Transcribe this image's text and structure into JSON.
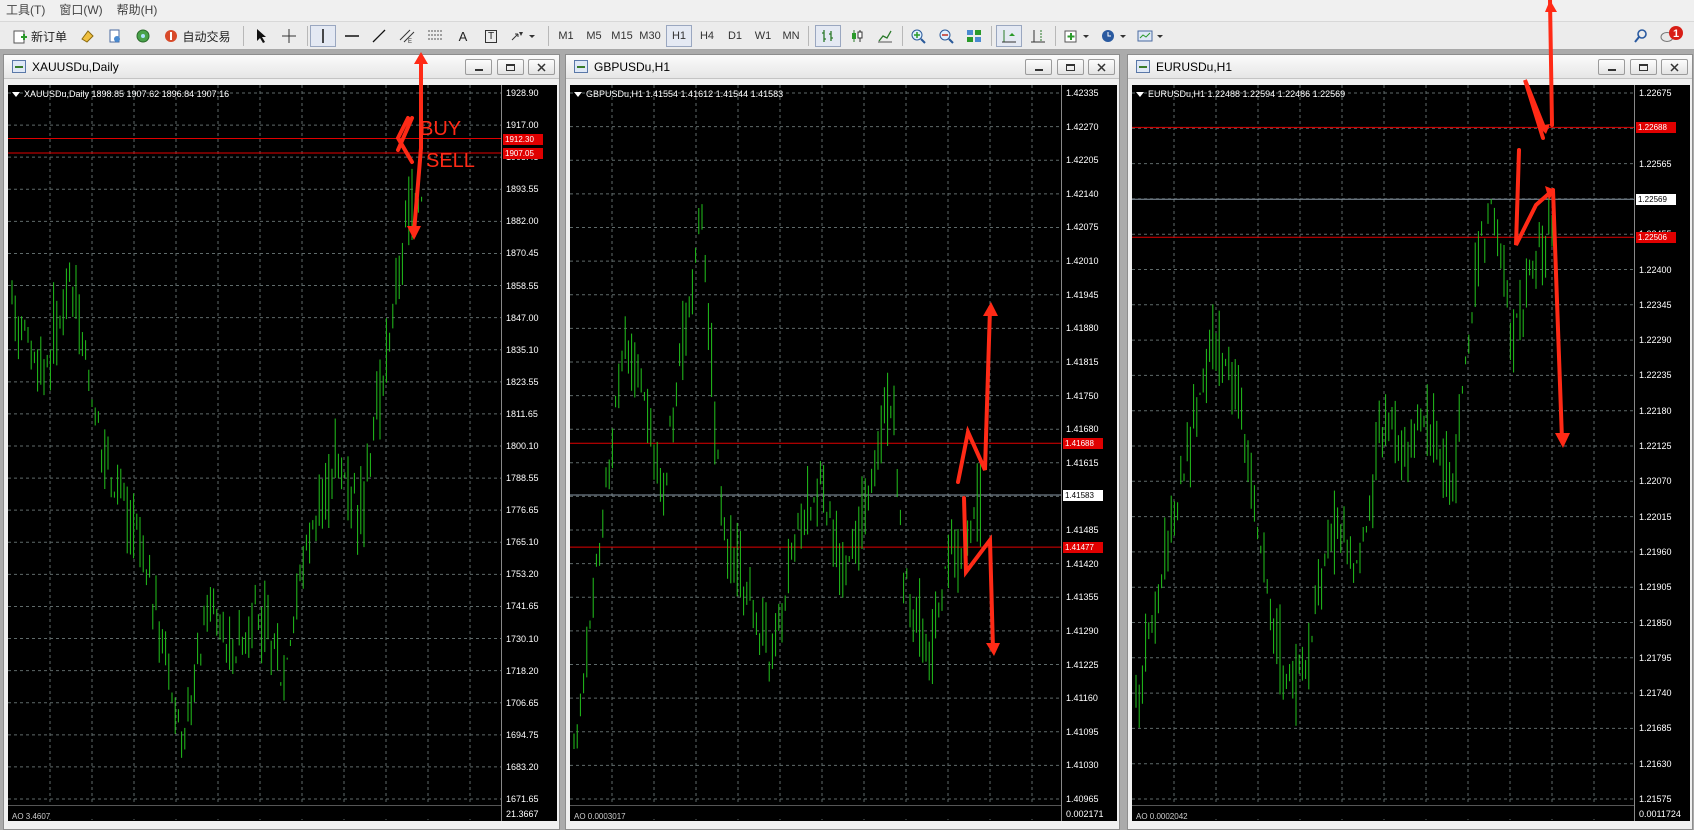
{
  "menu": [
    "工具(T)",
    "窗口(W)",
    "帮助(H)"
  ],
  "toolbar": {
    "new_order": "新订单",
    "auto_trade": "自动交易",
    "text_tool": "A",
    "text_label_tool": "T",
    "timeframes": [
      "M1",
      "M5",
      "M15",
      "M30",
      "H1",
      "H4",
      "D1",
      "W1",
      "MN"
    ],
    "active_timeframe": "H1",
    "notification_count": "1"
  },
  "windows": [
    {
      "title": "XAUUSDu,Daily",
      "info": "XAUUSDu,Daily  1898.85 1907.62 1896.84 1907.16",
      "ticks": [
        "1928.90",
        "1917.00",
        "1905.45",
        "1893.55",
        "1882.00",
        "1870.45",
        "1858.55",
        "1847.00",
        "1835.10",
        "1823.55",
        "1811.65",
        "1800.10",
        "1788.55",
        "1776.65",
        "1765.10",
        "1753.20",
        "1741.65",
        "1730.10",
        "1718.20",
        "1706.65",
        "1694.75",
        "1683.20",
        "1671.65"
      ],
      "tags": [
        {
          "text": "1912.30",
          "value": 1912.3,
          "kind": "red"
        },
        {
          "text": "1907.05",
          "value": 1907.05,
          "kind": "red"
        }
      ],
      "lines": [
        {
          "value": 1912.3,
          "color": "#e00000"
        },
        {
          "value": 1907.05,
          "color": "#e00000"
        }
      ],
      "subwindow": {
        "label": "AO 3.4607",
        "value": "21.3667"
      },
      "annotations": [
        "BUY",
        "SELL"
      ],
      "chart_data": {
        "type": "bar",
        "symbol": "XAUUSDu",
        "timeframe": "Daily",
        "ylim": [
          1671.65,
          1928.9
        ],
        "grid": true,
        "ohlc_last": {
          "open": 1898.85,
          "high": 1907.62,
          "low": 1896.84,
          "close": 1907.16
        }
      }
    },
    {
      "title": "GBPUSDu,H1",
      "info": "GBPUSDu,H1  1.41554 1.41612 1.41544 1.41583",
      "ticks": [
        "1.42335",
        "1.42270",
        "1.42205",
        "1.42140",
        "1.42075",
        "1.42010",
        "1.41945",
        "1.41880",
        "1.41815",
        "1.41750",
        "1.41680",
        "1.41615",
        "1.41550",
        "1.41485",
        "1.41420",
        "1.41355",
        "1.41290",
        "1.41225",
        "1.41160",
        "1.41095",
        "1.41030",
        "1.40965"
      ],
      "tags": [
        {
          "text": "1.41688",
          "value": 1.41688,
          "kind": "red"
        },
        {
          "text": "1.41583",
          "value": 1.41583,
          "kind": "bid"
        },
        {
          "text": "1.41477",
          "value": 1.41477,
          "kind": "red"
        }
      ],
      "lines": [
        {
          "value": 1.41688,
          "color": "#e00000"
        },
        {
          "value": 1.41583,
          "color": "#8a9aa8"
        },
        {
          "value": 1.41477,
          "color": "#e00000"
        }
      ],
      "subwindow": {
        "label": "AO 0.0003017",
        "value": "0.002171"
      },
      "annotations": [],
      "chart_data": {
        "type": "bar",
        "symbol": "GBPUSDu",
        "timeframe": "H1",
        "ylim": [
          1.40965,
          1.424
        ],
        "grid": true,
        "ohlc_last": {
          "open": 1.41554,
          "high": 1.41612,
          "low": 1.41544,
          "close": 1.41583
        }
      }
    },
    {
      "title": "EURUSDu,H1",
      "info": "EURUSDu,H1  1.22488 1.22594 1.22486 1.22569",
      "ticks": [
        "1.22675",
        "1.22620",
        "1.22565",
        "1.22510",
        "1.22455",
        "1.22400",
        "1.22345",
        "1.22290",
        "1.22235",
        "1.22180",
        "1.22125",
        "1.22070",
        "1.22015",
        "1.21960",
        "1.21905",
        "1.21850",
        "1.21795",
        "1.21740",
        "1.21685",
        "1.21630",
        "1.21575"
      ],
      "tags": [
        {
          "text": "1.22688",
          "value": 1.22688,
          "kind": "red"
        },
        {
          "text": "1.22569",
          "value": 1.22569,
          "kind": "bid"
        },
        {
          "text": "1.22506",
          "value": 1.22506,
          "kind": "red"
        }
      ],
      "lines": [
        {
          "value": 1.22688,
          "color": "#e00000"
        },
        {
          "value": 1.22569,
          "color": "#8a9aa8"
        },
        {
          "value": 1.22506,
          "color": "#e00000"
        }
      ],
      "subwindow": {
        "label": "AO 0.0002042",
        "value": "0.0011724"
      },
      "annotations": [],
      "chart_data": {
        "type": "bar",
        "symbol": "EURUSDu",
        "timeframe": "H1",
        "ylim": [
          1.21575,
          1.22745
        ],
        "grid": true,
        "ohlc_last": {
          "open": 1.22488,
          "high": 1.22594,
          "low": 1.22486,
          "close": 1.22569
        }
      }
    }
  ],
  "colors": {
    "bars": "#22c21c",
    "level_line": "#e00000",
    "bid_line": "#8a9aa8",
    "annotation": "#ff2a16",
    "grid": "#5f6a6a"
  }
}
